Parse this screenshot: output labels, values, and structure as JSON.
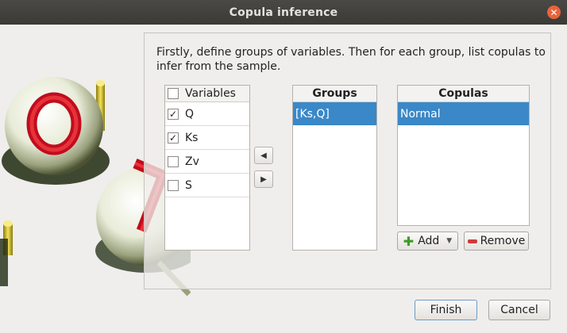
{
  "window": {
    "title": "Copula inference"
  },
  "instructions": "Firstly, define groups of variables. Then for each group, list copulas to infer from the sample.",
  "variables": {
    "header": "Variables",
    "items": [
      {
        "label": "Q",
        "checked": true
      },
      {
        "label": "Ks",
        "checked": true
      },
      {
        "label": "Zv",
        "checked": false
      },
      {
        "label": "S",
        "checked": false
      }
    ]
  },
  "groups": {
    "header": "Groups",
    "items": [
      "[Ks,Q]"
    ]
  },
  "copulas": {
    "header": "Copulas",
    "items": [
      "Normal"
    ]
  },
  "buttons": {
    "add": "Add",
    "remove": "Remove",
    "finish": "Finish",
    "cancel": "Cancel"
  },
  "colors": {
    "selection": "#3a88c8",
    "titlebar": "#3b3a36",
    "close": "#e9643a"
  }
}
